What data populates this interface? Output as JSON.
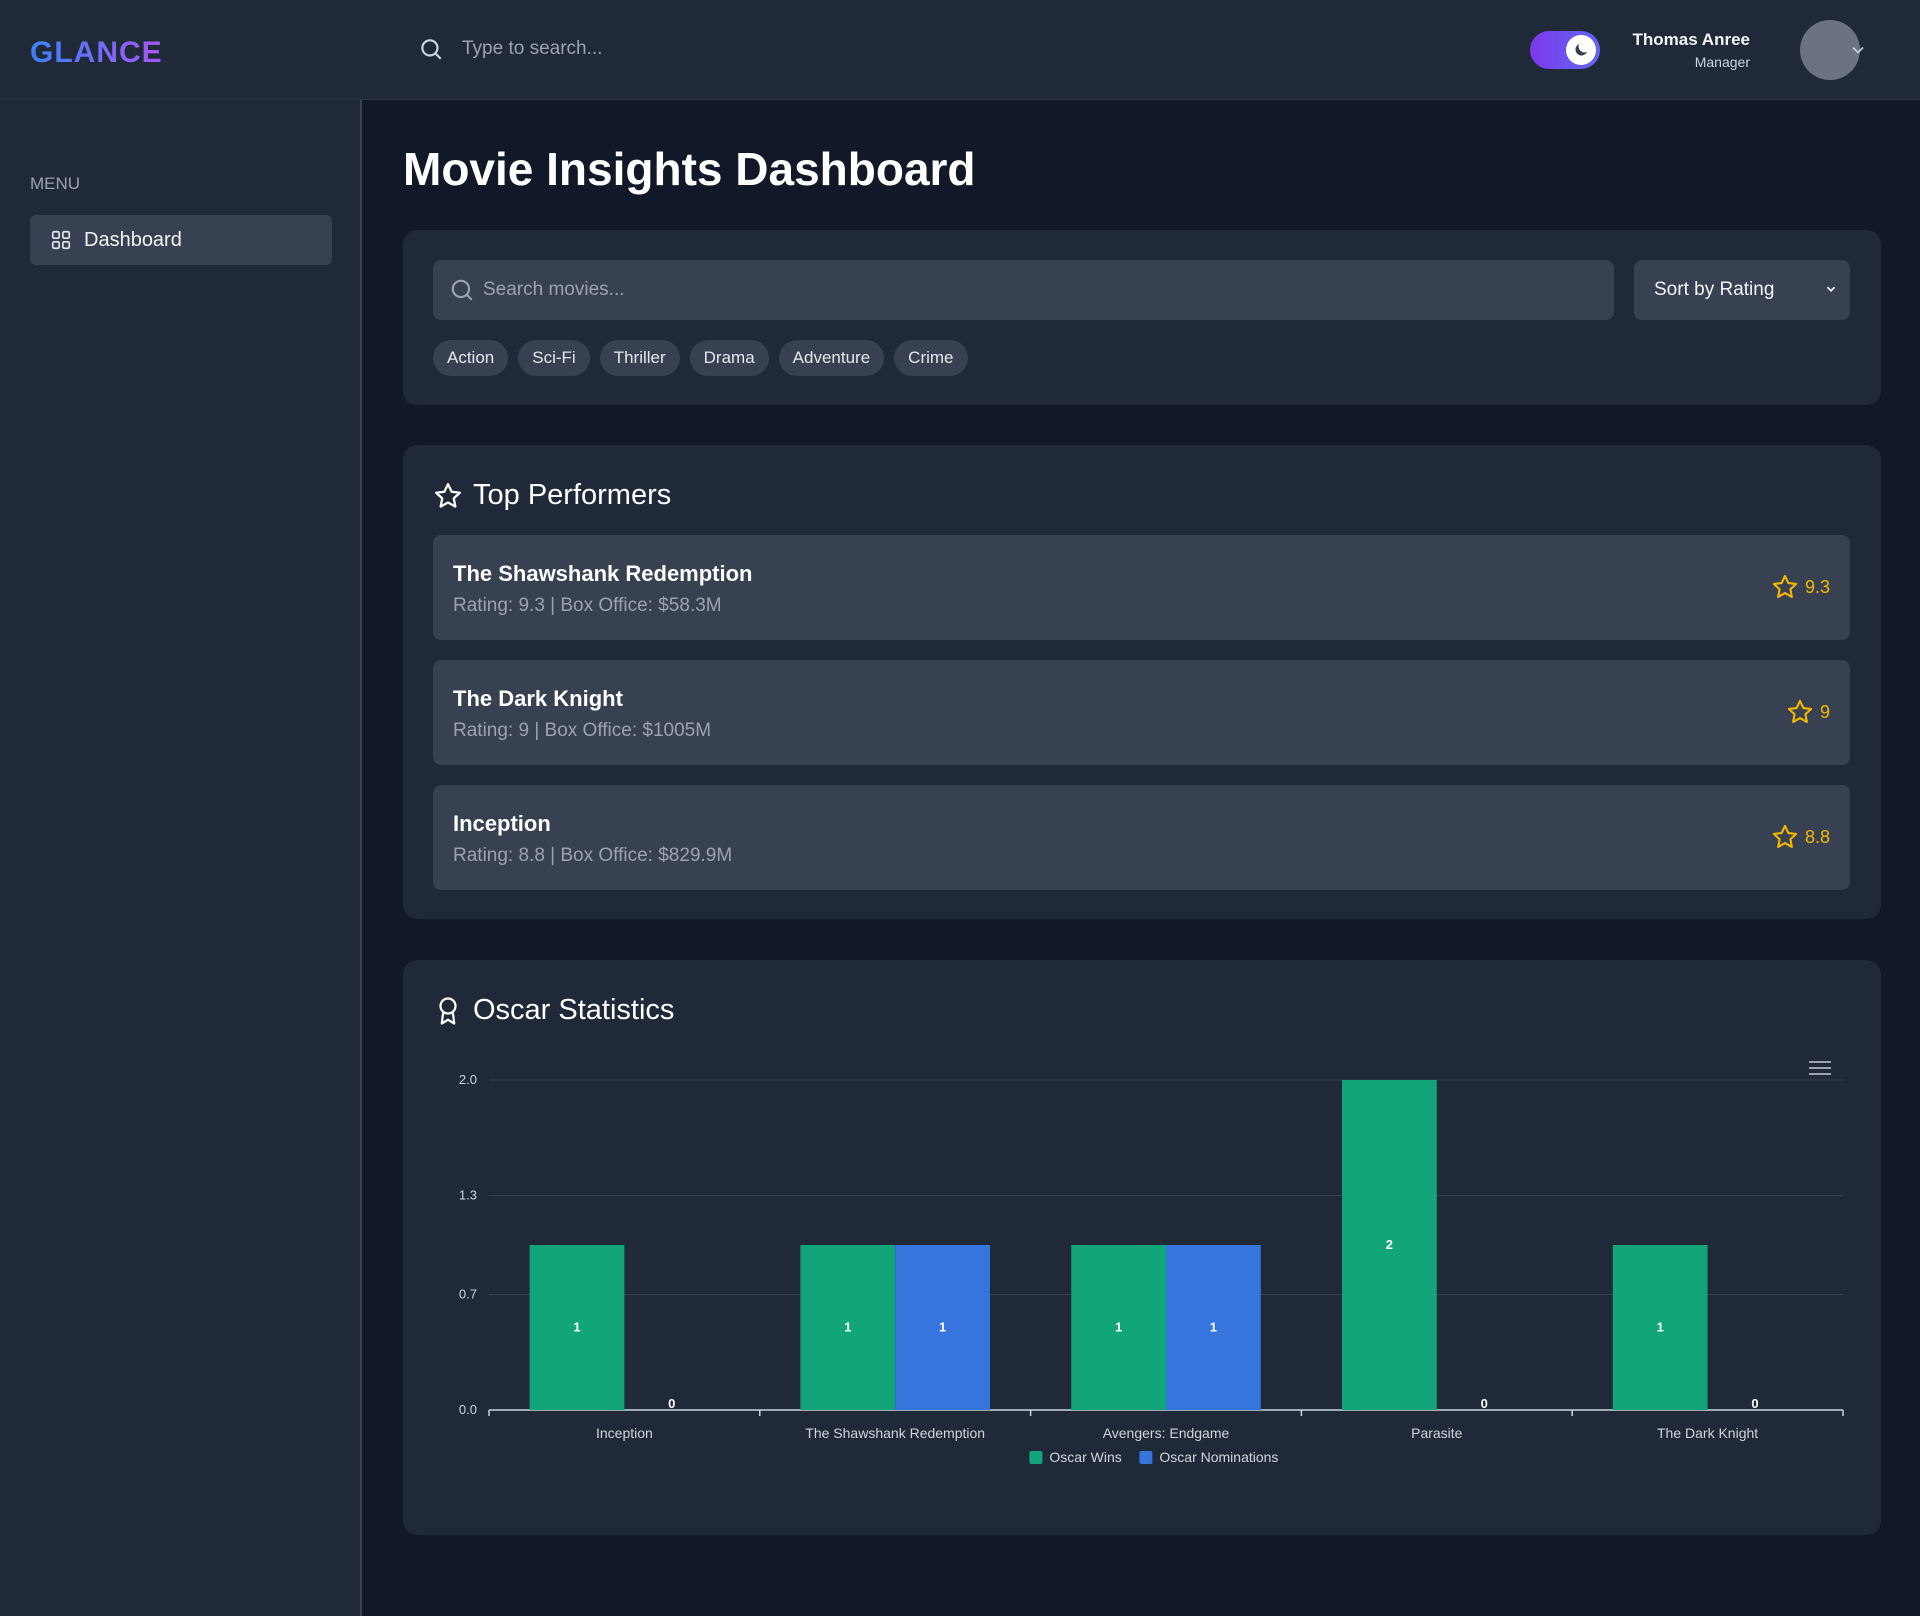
{
  "header": {
    "logo": "GLANCE",
    "search_placeholder": "Type to search...",
    "user_name": "Thomas Anree",
    "user_role": "Manager"
  },
  "sidebar": {
    "menu_label": "MENU",
    "items": [
      {
        "label": "Dashboard",
        "icon": "grid-icon",
        "active": true
      }
    ]
  },
  "main": {
    "title": "Movie Insights Dashboard",
    "filters": {
      "search_placeholder": "Search movies...",
      "sort_label": "Sort by Rating",
      "genres": [
        "Action",
        "Sci-Fi",
        "Thriller",
        "Drama",
        "Adventure",
        "Crime"
      ]
    },
    "top_performers": {
      "title": "Top Performers",
      "items": [
        {
          "title": "The Shawshank Redemption",
          "meta": "Rating: 9.3 | Box Office: $58.3M",
          "rating": "9.3"
        },
        {
          "title": "The Dark Knight",
          "meta": "Rating: 9 | Box Office: $1005M",
          "rating": "9"
        },
        {
          "title": "Inception",
          "meta": "Rating: 8.8 | Box Office: $829.9M",
          "rating": "8.8"
        }
      ]
    },
    "oscar": {
      "title": "Oscar Statistics"
    }
  },
  "colors": {
    "wins": "#12a57a",
    "nominations": "#3575dd",
    "star": "#f5b800",
    "accent": "#7c3aed"
  },
  "chart_data": {
    "type": "bar",
    "categories": [
      "Inception",
      "The Shawshank Redemption",
      "Avengers: Endgame",
      "Parasite",
      "The Dark Knight"
    ],
    "series": [
      {
        "name": "Oscar Wins",
        "values": [
          1,
          1,
          1,
          2,
          1
        ]
      },
      {
        "name": "Oscar Nominations",
        "values": [
          0,
          1,
          1,
          0,
          0
        ]
      }
    ],
    "yticks": [
      "0.0",
      "0.7",
      "1.3",
      "2.0"
    ],
    "ylim": [
      0,
      2
    ],
    "legend": "bottom-center",
    "grid": true
  }
}
